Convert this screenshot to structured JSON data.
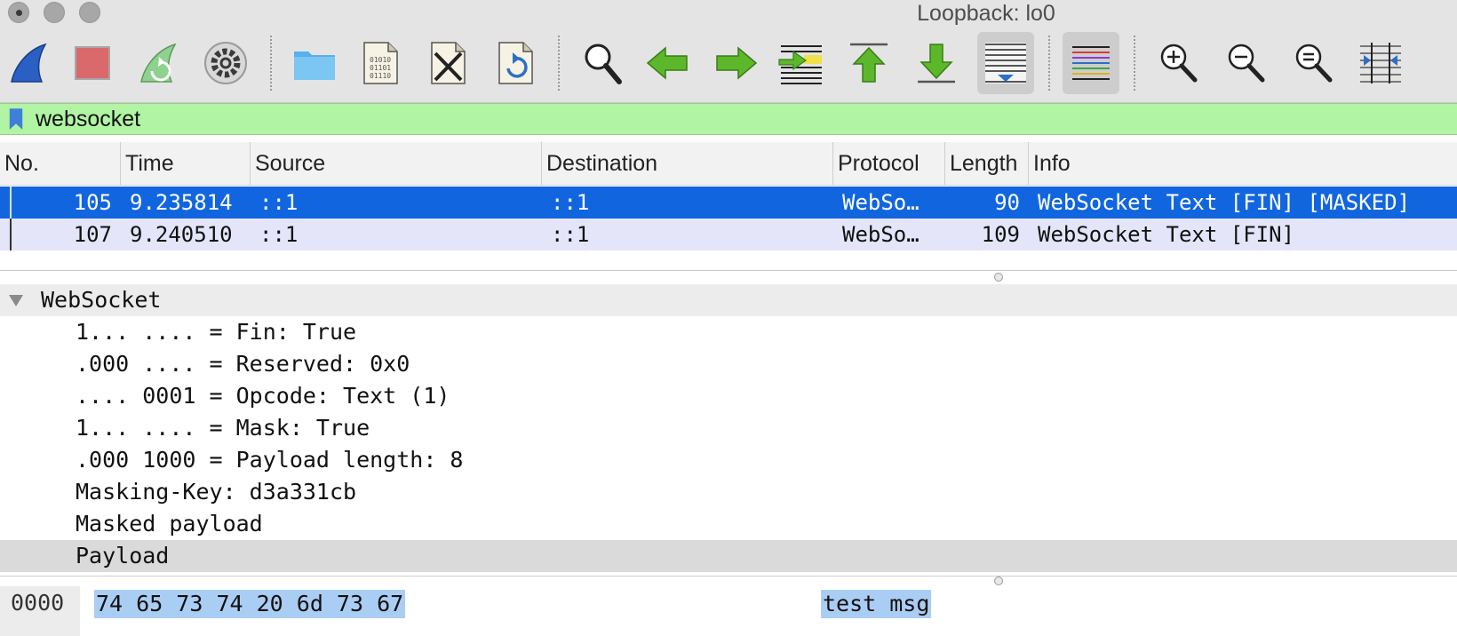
{
  "window": {
    "title": "Loopback: lo0"
  },
  "toolbar": {
    "buttons": [
      {
        "name": "start-capture",
        "icon": "shark-fin-icon"
      },
      {
        "name": "stop-capture",
        "icon": "stop-square-icon"
      },
      {
        "name": "restart-capture",
        "icon": "restart-fin-icon"
      },
      {
        "name": "capture-options",
        "icon": "gear-icon"
      },
      {
        "name": "open-file",
        "icon": "folder-icon"
      },
      {
        "name": "save-file",
        "icon": "binary-file-icon"
      },
      {
        "name": "close-file",
        "icon": "close-file-icon"
      },
      {
        "name": "reload-file",
        "icon": "reload-file-icon"
      },
      {
        "name": "find-packet",
        "icon": "magnifier-icon"
      },
      {
        "name": "go-back",
        "icon": "arrow-left-icon"
      },
      {
        "name": "go-forward",
        "icon": "arrow-right-icon"
      },
      {
        "name": "go-to-packet",
        "icon": "go-to-packet-icon"
      },
      {
        "name": "go-first-packet",
        "icon": "arrow-first-icon"
      },
      {
        "name": "go-last-packet",
        "icon": "arrow-last-icon"
      },
      {
        "name": "auto-scroll",
        "icon": "auto-scroll-icon"
      },
      {
        "name": "colorize",
        "icon": "colorize-lines-icon"
      },
      {
        "name": "zoom-in",
        "icon": "zoom-in-icon"
      },
      {
        "name": "zoom-out",
        "icon": "zoom-out-icon"
      },
      {
        "name": "normal-size",
        "icon": "zoom-reset-icon"
      },
      {
        "name": "resize-columns",
        "icon": "resize-columns-icon"
      }
    ]
  },
  "filter": {
    "value": "websocket",
    "bookmark_icon": "bookmark-icon",
    "color": "#b0f4a4"
  },
  "packet_list": {
    "columns": [
      "No.",
      "Time",
      "Source",
      "Destination",
      "Protocol",
      "Length",
      "Info"
    ],
    "rows": [
      {
        "no": "105",
        "time": "9.235814",
        "source": "::1",
        "destination": "::1",
        "protocol": "WebSo…",
        "length": "90",
        "info": "WebSocket Text [FIN] [MASKED]",
        "selected": true
      },
      {
        "no": "107",
        "time": "9.240510",
        "source": "::1",
        "destination": "::1",
        "protocol": "WebSo…",
        "length": "109",
        "info": "WebSocket Text [FIN]",
        "selected": false
      }
    ],
    "selection_color": "#1166e0"
  },
  "details": {
    "root": "WebSocket",
    "lines": [
      "1... .... = Fin: True",
      ".000 .... = Reserved: 0x0",
      ".... 0001 = Opcode: Text (1)",
      "1... .... = Mask: True",
      ".000 1000 = Payload length: 8",
      "Masking-Key: d3a331cb",
      "Masked payload",
      "Payload"
    ]
  },
  "bytes": {
    "offset": "0000",
    "hex": "74 65 73 74 20 6d 73 67",
    "ascii": "test msg"
  }
}
